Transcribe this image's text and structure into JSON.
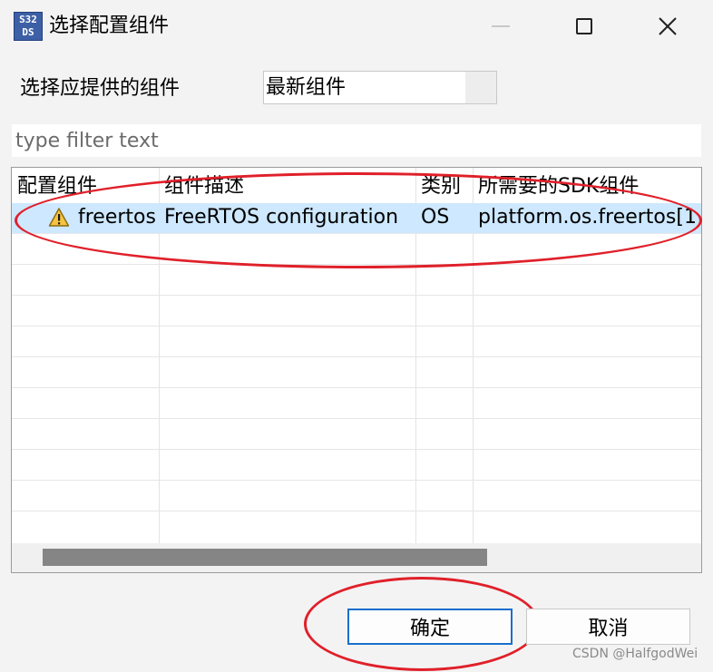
{
  "window": {
    "title": "选择配置组件",
    "app_icon_text": [
      "S32",
      "DS"
    ]
  },
  "selector": {
    "label": "选择应提供的组件",
    "value": "最新组件"
  },
  "filter": {
    "placeholder": "type filter text",
    "value": ""
  },
  "table": {
    "columns": [
      "配置组件",
      "组件描述",
      "类别",
      "所需要的SDK组件"
    ],
    "rows": [
      {
        "icon": "warning-icon",
        "component": "freertos",
        "description": "FreeRTOS configuration",
        "category": "OS",
        "sdk": "platform.os.freertos[1"
      }
    ]
  },
  "buttons": {
    "ok": "确定",
    "cancel": "取消"
  },
  "annotations": {
    "color": "#e0202a"
  },
  "watermark": "CSDN @HalfgodWei"
}
